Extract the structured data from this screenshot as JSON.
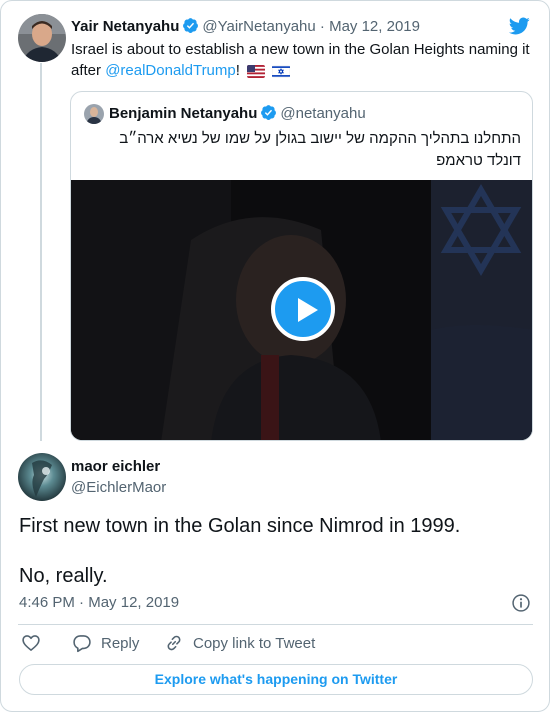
{
  "parent_tweet": {
    "author_name": "Yair Netanyahu",
    "handle": "@YairNetanyahu",
    "separator": "·",
    "date": "May 12, 2019",
    "text_before": "Israel is about to establish a new town in the Golan Heights naming it after ",
    "mention": "@realDonaldTrump",
    "text_after": "!",
    "flags": [
      "us-flag-icon",
      "israel-flag-icon"
    ]
  },
  "quoted_tweet": {
    "author_name": "Benjamin Netanyahu",
    "handle": "@netanyahu",
    "text": "התחלנו בתהליך ההקמה של יישוב בגולן על שמו של נשיא ארה״ב דונלד טראמפ",
    "media_type": "video"
  },
  "reply_tweet": {
    "author_name": "maor eichler",
    "handle": "@EichlerMaor",
    "text_line1": "First new town in the Golan since Nimrod in 1999.",
    "text_line2": "No, really.",
    "time": "4:46 PM",
    "separator": "·",
    "date": "May 12, 2019"
  },
  "actions": {
    "like_icon": "heart-icon",
    "reply_label": "Reply",
    "copy_link_label": "Copy link to Tweet"
  },
  "explore_label": "Explore what's happening on Twitter",
  "colors": {
    "accent": "#1d9bf0",
    "text": "#0f1419",
    "muted": "#536471",
    "border": "#cfd9de"
  }
}
